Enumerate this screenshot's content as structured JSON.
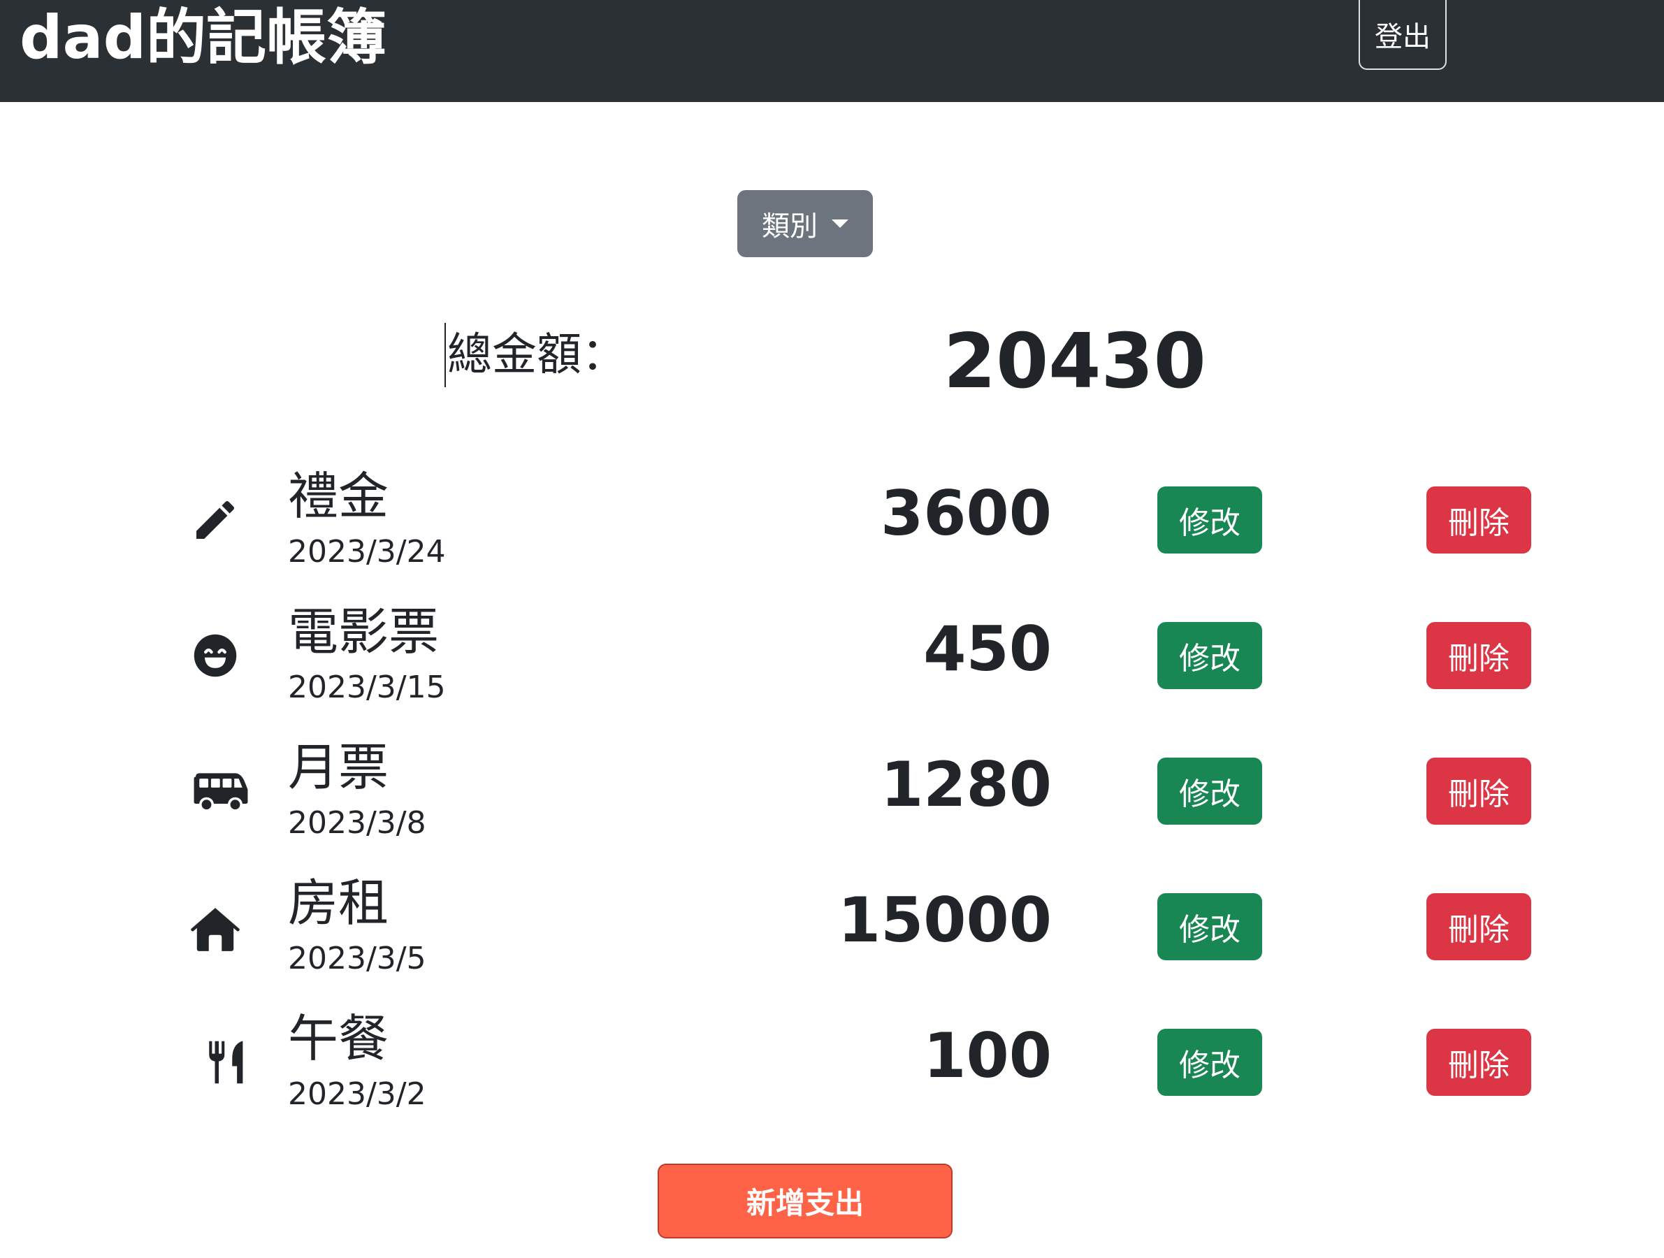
{
  "header": {
    "brand": "dad的記帳簿",
    "logout_label": "登出"
  },
  "filter": {
    "category_label": "類別"
  },
  "summary": {
    "total_label": "總金額：",
    "total_value": "20430"
  },
  "records": [
    {
      "icon": "pencil-icon",
      "name": "禮金",
      "date": "2023/3/24",
      "amount": "3600",
      "edit_label": "修改",
      "delete_label": "刪除"
    },
    {
      "icon": "grin-face-icon",
      "name": "電影票",
      "date": "2023/3/15",
      "amount": "450",
      "edit_label": "修改",
      "delete_label": "刪除"
    },
    {
      "icon": "bus-icon",
      "name": "月票",
      "date": "2023/3/8",
      "amount": "1280",
      "edit_label": "修改",
      "delete_label": "刪除"
    },
    {
      "icon": "house-icon",
      "name": "房租",
      "date": "2023/3/5",
      "amount": "15000",
      "edit_label": "修改",
      "delete_label": "刪除"
    },
    {
      "icon": "utensils-icon",
      "name": "午餐",
      "date": "2023/3/2",
      "amount": "100",
      "edit_label": "修改",
      "delete_label": "刪除"
    }
  ],
  "actions": {
    "add_expense_label": "新增支出"
  },
  "colors": {
    "navbar": "#2b3035",
    "category_button": "#6c757d",
    "edit_button": "#198754",
    "delete_button": "#dc3545",
    "add_button": "#ff6347"
  }
}
